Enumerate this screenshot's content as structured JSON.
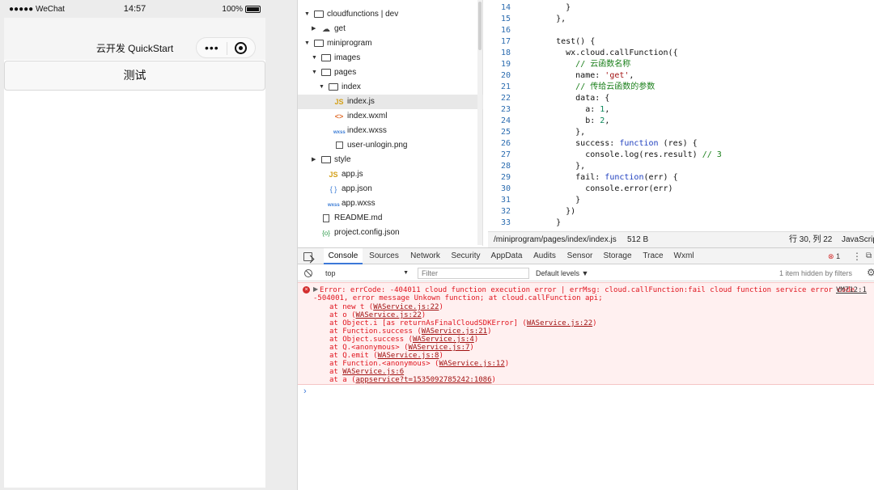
{
  "simulator": {
    "status": {
      "carrier": "●●●●● WeChat",
      "time": "14:57",
      "battery": "100%"
    },
    "nav_title": "云开发 QuickStart",
    "capsule_more": "•••",
    "button_label": "测试"
  },
  "file_tree": [
    {
      "name": "cloudfunctions | dev",
      "type": "folder",
      "icon": "folder-cloud-icon",
      "arrow": "▼",
      "depth": 0
    },
    {
      "name": "get",
      "type": "folder",
      "icon": "cloud-icon",
      "arrow": "▶",
      "depth": 1
    },
    {
      "name": "miniprogram",
      "type": "folder",
      "icon": "folder-icon",
      "arrow": "▼",
      "depth": 0
    },
    {
      "name": "images",
      "type": "folder",
      "icon": "folder-icon",
      "arrow": "▼",
      "depth": 1
    },
    {
      "name": "pages",
      "type": "folder",
      "icon": "folder-icon",
      "arrow": "▼",
      "depth": 1
    },
    {
      "name": "index",
      "type": "folder",
      "icon": "folder-icon",
      "arrow": "▼",
      "depth": 2
    },
    {
      "name": "index.js",
      "type": "js",
      "icon": "js-file-icon",
      "arrow": "",
      "depth": 3,
      "selected": true
    },
    {
      "name": "index.wxml",
      "type": "xml",
      "icon": "wxml-file-icon",
      "arrow": "",
      "depth": 3
    },
    {
      "name": "index.wxss",
      "type": "wxss",
      "icon": "wxss-file-icon",
      "arrow": "",
      "depth": 3
    },
    {
      "name": "user-unlogin.png",
      "type": "img",
      "icon": "image-file-icon",
      "arrow": "",
      "depth": 3
    },
    {
      "name": "style",
      "type": "folder",
      "icon": "folder-icon",
      "arrow": "▶",
      "depth": 1
    },
    {
      "name": "app.js",
      "type": "js",
      "icon": "js-file-icon",
      "arrow": "",
      "depth": 2
    },
    {
      "name": "app.json",
      "type": "json",
      "icon": "json-file-icon",
      "arrow": "",
      "depth": 2
    },
    {
      "name": "app.wxss",
      "type": "wxss",
      "icon": "wxss-file-icon",
      "arrow": "",
      "depth": 2
    },
    {
      "name": "README.md",
      "type": "doc",
      "icon": "document-icon",
      "arrow": "",
      "depth": 1
    },
    {
      "name": "project.config.json",
      "type": "config",
      "icon": "config-file-icon",
      "arrow": "",
      "depth": 1
    }
  ],
  "editor": {
    "lines": [
      {
        "n": "14",
        "tokens": [
          [
            "      }",
            ""
          ]
        ]
      },
      {
        "n": "15",
        "tokens": [
          [
            "    },",
            ""
          ]
        ]
      },
      {
        "n": "16",
        "tokens": [
          [
            "",
            ""
          ]
        ]
      },
      {
        "n": "17",
        "tokens": [
          [
            "    test() {",
            ""
          ]
        ]
      },
      {
        "n": "18",
        "tokens": [
          [
            "      wx.cloud.callFunction({",
            ""
          ]
        ]
      },
      {
        "n": "19",
        "tokens": [
          [
            "        ",
            ""
          ],
          [
            "// 云函数名称",
            "cm"
          ]
        ]
      },
      {
        "n": "20",
        "tokens": [
          [
            "        name: ",
            ""
          ],
          [
            "'get'",
            "str"
          ],
          [
            ",",
            ""
          ]
        ]
      },
      {
        "n": "21",
        "tokens": [
          [
            "        ",
            ""
          ],
          [
            "// 传给云函数的参数",
            "cm"
          ]
        ]
      },
      {
        "n": "22",
        "tokens": [
          [
            "        data: {",
            ""
          ]
        ]
      },
      {
        "n": "23",
        "tokens": [
          [
            "          a: ",
            ""
          ],
          [
            "1",
            "num"
          ],
          [
            ",",
            ""
          ]
        ]
      },
      {
        "n": "24",
        "tokens": [
          [
            "          b: ",
            ""
          ],
          [
            "2",
            "num"
          ],
          [
            ",",
            ""
          ]
        ]
      },
      {
        "n": "25",
        "tokens": [
          [
            "        },",
            ""
          ]
        ]
      },
      {
        "n": "26",
        "tokens": [
          [
            "        success: ",
            ""
          ],
          [
            "function",
            "kw"
          ],
          [
            " (res) {",
            ""
          ]
        ]
      },
      {
        "n": "27",
        "tokens": [
          [
            "          console.log(res.result) ",
            ""
          ],
          [
            "// 3",
            "cm"
          ]
        ]
      },
      {
        "n": "28",
        "tokens": [
          [
            "        },",
            ""
          ]
        ]
      },
      {
        "n": "29",
        "tokens": [
          [
            "        fail: ",
            ""
          ],
          [
            "function",
            "kw"
          ],
          [
            "(err) {",
            ""
          ]
        ]
      },
      {
        "n": "30",
        "tokens": [
          [
            "          console.error(err)",
            ""
          ]
        ]
      },
      {
        "n": "31",
        "tokens": [
          [
            "        }",
            ""
          ]
        ]
      },
      {
        "n": "32",
        "tokens": [
          [
            "      })",
            ""
          ]
        ]
      },
      {
        "n": "33",
        "tokens": [
          [
            "    }",
            ""
          ]
        ]
      }
    ],
    "status": {
      "path": "/miniprogram/pages/index/index.js",
      "size": "512 B",
      "position": "行 30, 列 22",
      "language": "JavaScript"
    }
  },
  "devtools": {
    "tabs": [
      {
        "label": "Console",
        "active": true
      },
      {
        "label": "Sources"
      },
      {
        "label": "Network"
      },
      {
        "label": "Security"
      },
      {
        "label": "AppData"
      },
      {
        "label": "Audits"
      },
      {
        "label": "Sensor"
      },
      {
        "label": "Storage"
      },
      {
        "label": "Trace"
      },
      {
        "label": "Wxml"
      }
    ],
    "error_count": "1",
    "toolbar": {
      "context": "top",
      "filter_placeholder": "Filter",
      "levels": "Default levels ▼",
      "hidden_note": "1 item hidden by filters"
    },
    "error": {
      "line1": "Error: errCode: -404011 cloud function execution error | errMsg: cloud.callFunction:fail cloud function service error code",
      "line2": "-504001, error message Unkown function; at cloud.callFunction api;",
      "source": "VM712:1",
      "stack": [
        {
          "prefix": "at new t (",
          "link": "WAService.js:22",
          "suffix": ")"
        },
        {
          "prefix": "at o (",
          "link": "WAService.js:22",
          "suffix": ")"
        },
        {
          "prefix": "at Object.i [as returnAsFinalCloudSDKError] (",
          "link": "WAService.js:22",
          "suffix": ")"
        },
        {
          "prefix": "at Function.success (",
          "link": "WAService.js:21",
          "suffix": ")"
        },
        {
          "prefix": "at Object.success (",
          "link": "WAService.js:4",
          "suffix": ")"
        },
        {
          "prefix": "at Q.<anonymous> (",
          "link": "WAService.js:7",
          "suffix": ")"
        },
        {
          "prefix": "at Q.emit (",
          "link": "WAService.js:8",
          "suffix": ")"
        },
        {
          "prefix": "at Function.<anonymous> (",
          "link": "WAService.js:12",
          "suffix": ")"
        },
        {
          "prefix": "at ",
          "link": "WAService.js:6",
          "suffix": ""
        },
        {
          "prefix": "at a (",
          "link": "appservice?t=1535092785242:1086",
          "suffix": ")"
        }
      ]
    },
    "prompt": "›"
  }
}
